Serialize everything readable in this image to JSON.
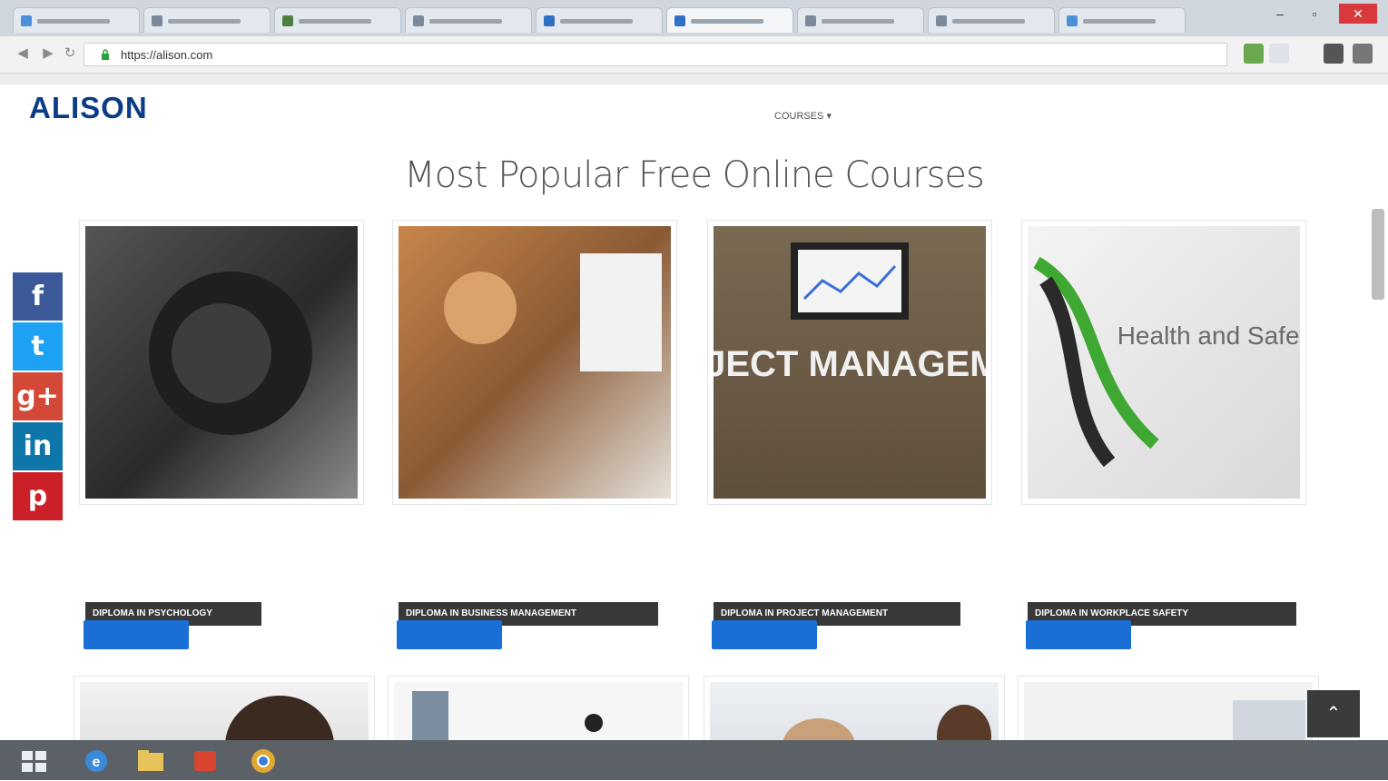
{
  "browser": {
    "tabs": [
      {
        "label": "",
        "color": "#4a90d9"
      },
      {
        "label": "",
        "color": "#7a8a9a"
      },
      {
        "label": "",
        "color": "#4f7f3f"
      },
      {
        "label": "",
        "color": "#7a8a9a"
      },
      {
        "label": "",
        "color": "#2f6fc4"
      },
      {
        "label": "",
        "color": "#2f6fc4"
      },
      {
        "label": "",
        "color": "#7a8a9a"
      },
      {
        "label": "",
        "color": "#7a8a9a"
      },
      {
        "label": "",
        "color": "#4a90d9"
      }
    ],
    "url": "https://alison.com",
    "window_controls": {
      "minimize": "–",
      "maximize": "▫",
      "close": "✕"
    }
  },
  "site": {
    "logo": "ALISON",
    "tagline": "",
    "nav": [
      {
        "label": "COURSES ▾",
        "style": "normal"
      },
      {
        "label": "",
        "style": "normal"
      },
      {
        "label": "",
        "style": "normal"
      },
      {
        "label": "",
        "style": "blue"
      },
      {
        "label": "",
        "style": "blue"
      }
    ]
  },
  "heading": "Most Popular Free Online Courses",
  "social": [
    {
      "name": "facebook-icon",
      "glyph": "f",
      "color": "#3b5998"
    },
    {
      "name": "twitter-icon",
      "glyph": "t",
      "color": "#1da1f2"
    },
    {
      "name": "googleplus-icon",
      "glyph": "g+",
      "color": "#d34836"
    },
    {
      "name": "linkedin-icon",
      "glyph": "in",
      "color": "#0e76a8"
    },
    {
      "name": "pinterest-icon",
      "glyph": "p",
      "color": "#cb2027"
    }
  ],
  "courses": [
    {
      "badge": "DIPLOMA IN PSYCHOLOGY",
      "image_text": "",
      "description": "",
      "button": "",
      "bg": "#3a3a3a"
    },
    {
      "badge": "DIPLOMA IN BUSINESS MANAGEMENT",
      "image_text": "",
      "description": "",
      "button": "",
      "bg": "#a06a3a"
    },
    {
      "badge": "DIPLOMA IN PROJECT MANAGEMENT",
      "image_text": "PROJECT MANAGEMENT",
      "description": "",
      "button": "",
      "bg": "#5a4a3a"
    },
    {
      "badge": "DIPLOMA IN WORKPLACE SAFETY",
      "image_text": "Health and Safety",
      "description": "",
      "button": "",
      "bg": "#e8e8e8"
    }
  ],
  "scroll_top_label": "⌃",
  "taskbar": {
    "items": [
      {
        "name": "start-button",
        "color": "#6f7a84"
      },
      {
        "name": "internet-explorer-icon",
        "color": "#3a8ad8"
      },
      {
        "name": "file-explorer-icon",
        "color": "#e8c25a"
      },
      {
        "name": "app-icon",
        "color": "#d9452e"
      },
      {
        "name": "chrome-icon",
        "color": "#e0a732"
      }
    ],
    "tray_text": ""
  }
}
